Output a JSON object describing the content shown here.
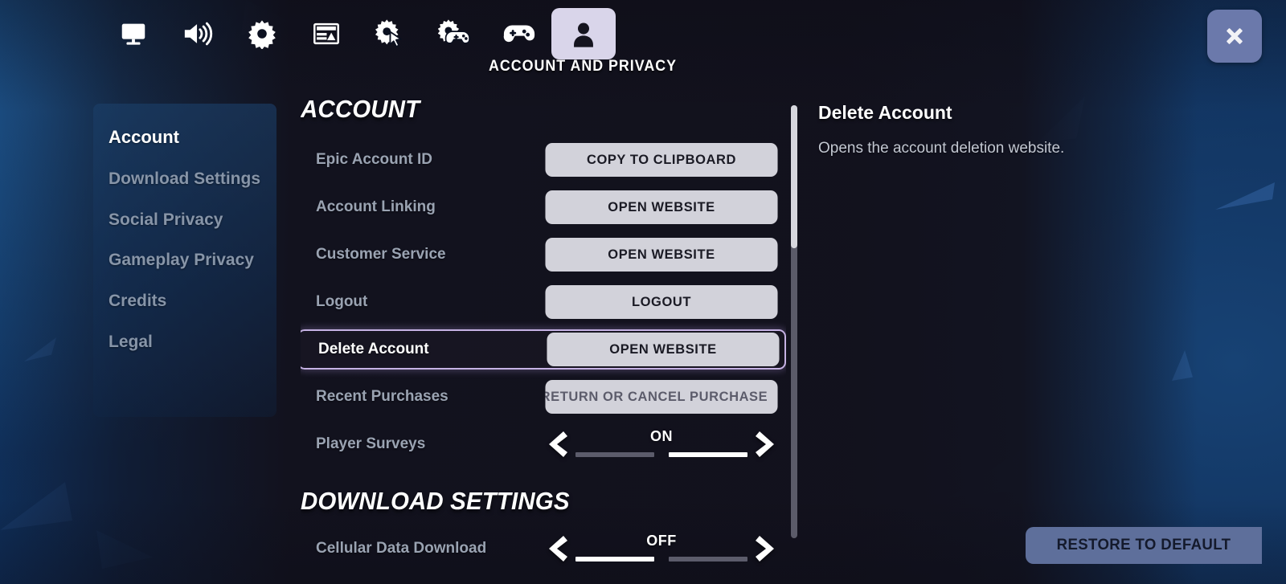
{
  "topbar": {
    "tabs": [
      {
        "icon": "monitor-icon",
        "name": "video-settings-tab",
        "active": false
      },
      {
        "icon": "speaker-icon",
        "name": "audio-settings-tab",
        "active": false
      },
      {
        "icon": "gear-icon",
        "name": "game-settings-tab",
        "active": false
      },
      {
        "icon": "hud-layout-icon",
        "name": "hud-layout-tab",
        "active": false
      },
      {
        "icon": "gear-cursor-icon",
        "name": "input-settings-tab",
        "active": false
      },
      {
        "icon": "gear-gamepad-icon",
        "name": "controller-settings-tab",
        "active": false
      },
      {
        "icon": "gamepad-icon",
        "name": "keyboard-controls-tab",
        "active": false
      },
      {
        "icon": "person-icon",
        "name": "account-and-privacy-tab",
        "active": true
      }
    ],
    "active_tab_title": "ACCOUNT AND PRIVACY",
    "close_label": "close-icon",
    "close_color": "#6b79ab",
    "active_tab_bg": "#d9d5ea"
  },
  "sidebar": {
    "items": [
      {
        "label": "Account",
        "active": true
      },
      {
        "label": "Download Settings",
        "active": false
      },
      {
        "label": "Social Privacy",
        "active": false
      },
      {
        "label": "Gameplay Privacy",
        "active": false
      },
      {
        "label": "Credits",
        "active": false
      },
      {
        "label": "Legal",
        "active": false
      }
    ]
  },
  "main": {
    "sections": [
      {
        "heading": "ACCOUNT",
        "rows": [
          {
            "label": "Epic Account ID",
            "control": "button",
            "value": "COPY TO CLIPBOARD",
            "highlight": false,
            "disabled": false,
            "clipped": false
          },
          {
            "label": "Account Linking",
            "control": "button",
            "value": "OPEN WEBSITE",
            "highlight": false,
            "disabled": false,
            "clipped": false
          },
          {
            "label": "Customer Service",
            "control": "button",
            "value": "OPEN WEBSITE",
            "highlight": false,
            "disabled": false,
            "clipped": false
          },
          {
            "label": "Logout",
            "control": "button",
            "value": "LOGOUT",
            "highlight": false,
            "disabled": false,
            "clipped": false
          },
          {
            "label": "Delete Account",
            "control": "button",
            "value": "OPEN WEBSITE",
            "highlight": true,
            "disabled": false,
            "clipped": false
          },
          {
            "label": "Recent Purchases",
            "control": "button",
            "value": "RETURN OR CANCEL PURCHASE",
            "highlight": false,
            "disabled": true,
            "clipped": true
          },
          {
            "label": "Player Surveys",
            "control": "toggle",
            "value": "ON",
            "highlight": false,
            "state_index": 1
          }
        ]
      },
      {
        "heading": "DOWNLOAD SETTINGS",
        "rows": [
          {
            "label": "Cellular Data Download",
            "control": "toggle",
            "value": "OFF",
            "highlight": false,
            "state_index": 0
          }
        ]
      }
    ],
    "highlight_color": "#c6b2e4"
  },
  "scrollbar": {
    "name": "main-list-scrollbar",
    "thumb_position_pct": 0,
    "thumb_size_pct": 33
  },
  "description": {
    "title": "Delete Account",
    "body": "Opens the account deletion website."
  },
  "footer": {
    "restore_label": "RESTORE TO DEFAULT",
    "restore_color": "#5e6f9b"
  }
}
